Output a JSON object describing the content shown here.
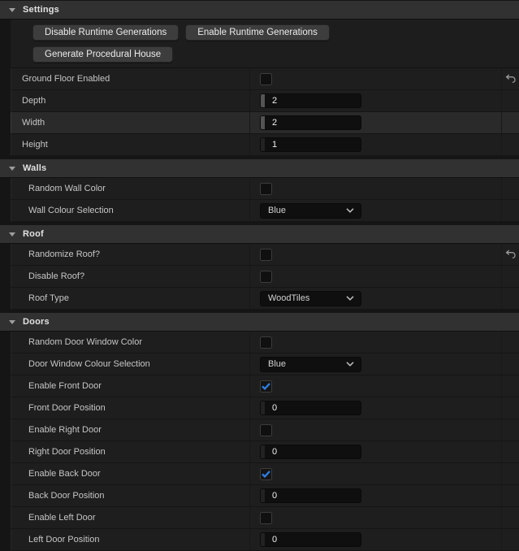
{
  "colors": {
    "accent_blue": "#2b7ce0",
    "panel_bg": "#151515",
    "row_bg": "#1e1e1e",
    "row_hover_bg": "#2a2a2a",
    "header_bg": "#313131",
    "input_bg": "#0f0f0f"
  },
  "icons": {
    "section_collapse": "triangle-down",
    "reset": "undo-arrow",
    "dropdown_chevron": "chevron-down",
    "checkbox_check": "check"
  },
  "sections": [
    {
      "id": "settings",
      "title": "Settings",
      "indent": 0,
      "button_rows": [
        [
          "Disable Runtime Generations",
          "Enable Runtime Generations"
        ],
        [
          "Generate Procedural House"
        ]
      ],
      "rows": [
        {
          "label": "Ground Floor Enabled",
          "kind": "checkbox",
          "checked": false,
          "reset": true
        },
        {
          "label": "Depth",
          "kind": "spin",
          "value": "2",
          "grip": "bright"
        },
        {
          "label": "Width",
          "kind": "spin",
          "value": "2",
          "grip": "bright",
          "hover": true
        },
        {
          "label": "Height",
          "kind": "spin",
          "value": "1",
          "grip": "dim"
        }
      ]
    },
    {
      "id": "walls",
      "title": "Walls",
      "indent": 1,
      "rows": [
        {
          "label": "Random Wall Color",
          "kind": "checkbox",
          "checked": false
        },
        {
          "label": "Wall Colour Selection",
          "kind": "dropdown",
          "value": "Blue"
        }
      ]
    },
    {
      "id": "roof",
      "title": "Roof",
      "indent": 1,
      "rows": [
        {
          "label": "Randomize Roof?",
          "kind": "checkbox",
          "checked": false,
          "reset": true
        },
        {
          "label": "Disable Roof?",
          "kind": "checkbox",
          "checked": false
        },
        {
          "label": "Roof Type",
          "kind": "dropdown",
          "value": "WoodTiles"
        }
      ]
    },
    {
      "id": "doors",
      "title": "Doors",
      "indent": 1,
      "rows": [
        {
          "label": "Random Door Window Color",
          "kind": "checkbox",
          "checked": false
        },
        {
          "label": "Door Window Colour Selection",
          "kind": "dropdown",
          "value": "Blue"
        },
        {
          "label": "Enable Front Door",
          "kind": "checkbox",
          "checked": true
        },
        {
          "label": "Front Door Position",
          "kind": "spin",
          "value": "0",
          "grip": "dim"
        },
        {
          "label": "Enable Right Door",
          "kind": "checkbox",
          "checked": false
        },
        {
          "label": "Right Door Position",
          "kind": "spin",
          "value": "0",
          "grip": "dim"
        },
        {
          "label": "Enable Back Door",
          "kind": "checkbox",
          "checked": true
        },
        {
          "label": "Back Door Position",
          "kind": "spin",
          "value": "0",
          "grip": "dim"
        },
        {
          "label": "Enable Left Door",
          "kind": "checkbox",
          "checked": false
        },
        {
          "label": "Left Door Position",
          "kind": "spin",
          "value": "0",
          "grip": "dim"
        }
      ]
    }
  ]
}
